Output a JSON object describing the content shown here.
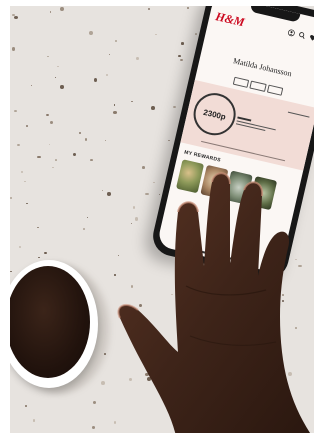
{
  "app": {
    "logo_text": "H&M",
    "brand_color": "#cc071e"
  },
  "nav_icons": [
    "user-icon",
    "search-icon",
    "heart-icon",
    "bag-icon"
  ],
  "profile": {
    "member_name": "Matilda Johansson",
    "points": "2300p"
  },
  "rewards": {
    "title": "MY REWARDS"
  },
  "colors": {
    "surface": "#e7e3df",
    "screen": "#fbf7f4",
    "member_panel": "#f2dcd6",
    "skin": "#3e2419"
  }
}
